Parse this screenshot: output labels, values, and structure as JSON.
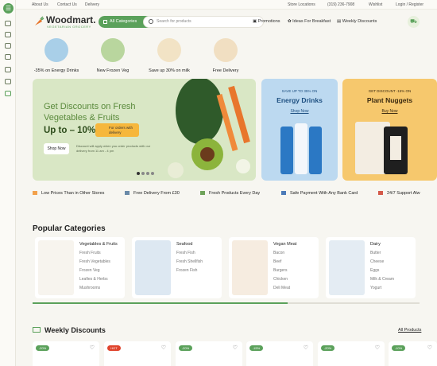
{
  "topbar": {
    "about": "About Us",
    "contact": "Contact Us",
    "delivery": "Delivery",
    "store": "Store Locations",
    "phone": "(319) 236-7908",
    "wishlist": "Wishlist",
    "login": "Login / Register"
  },
  "brand": {
    "name": "Woodmart.",
    "tagline": "VEGETARIAN GROCERY",
    "accent": "#5ba15b"
  },
  "header": {
    "all_categories": "All Categories",
    "search_placeholder": "Search for products",
    "promotions": "Promotions",
    "ideas": "Ideas For Breakfast",
    "weekly": "Weekly Discounts"
  },
  "quick_links": [
    {
      "label": "-35% on Energy Drinks",
      "color": "#a9cfe8"
    },
    {
      "label": "New Frozen Veg",
      "color": "#b9d69e"
    },
    {
      "label": "Save up 30% on milk",
      "color": "#f2e3c5"
    },
    {
      "label": "Free Delivery",
      "color": "#f1dfc2"
    }
  ],
  "hero": {
    "title": "Get Discounts on Fresh Vegetables & Fruits",
    "upto": "Up to – 10%",
    "badge": "For orders with delivery",
    "button": "Shop Now",
    "desc": "Discount will apply when you order products with our delivery from 11 am - 4 pm"
  },
  "promos": [
    {
      "kicker": "SAVE UP TO 35% ON",
      "title": "Energy Drinks",
      "button": "Shop Now",
      "bg": "#bcd9f0",
      "fg": "#1d4f80"
    },
    {
      "kicker": "GET DISCOUNT -15% ON",
      "title": "Plant Nuggets",
      "button": "Buy Now",
      "bg": "#f6c86d",
      "fg": "#3b2a10"
    }
  ],
  "features": [
    "Low Prices Than in Other Stores",
    "Free Delivery From £30",
    "Fresh Products Every Day",
    "Safe Payment With Any Bank Card",
    "24/7 Support Alw"
  ],
  "categories_title": "Popular Categories",
  "categories": [
    {
      "title": "Vegetables & Fruits",
      "items": [
        "Fresh Fruits",
        "Fresh Vegetables",
        "Frozen Veg",
        "Leafies & Herbs",
        "Mushrooms"
      ],
      "bg": "#f7f4ee"
    },
    {
      "title": "Seafood",
      "items": [
        "Fresh Fish",
        "Fresh Shellfish",
        "Frozen Fish"
      ],
      "bg": "#dde8f2"
    },
    {
      "title": "Vegan Meat",
      "items": [
        "Bacon",
        "Beef",
        "Burgers",
        "Chicken",
        "Deli Meat"
      ],
      "bg": "#f6ece0"
    },
    {
      "title": "Dairy",
      "items": [
        "Butter",
        "Cheese",
        "Eggs",
        "Milk & Cream",
        "Yogurt"
      ],
      "bg": "#e4ecf3"
    }
  ],
  "carousel_progress": 0.66,
  "weekly": {
    "title": "Weekly Discounts",
    "all": "All Products"
  },
  "products": [
    {
      "badge": "-20%"
    },
    {
      "badge": "HOT"
    },
    {
      "badge": "-20%"
    },
    {
      "badge": "-15%"
    },
    {
      "badge": "-20%"
    },
    {
      "badge": "-10%"
    }
  ]
}
